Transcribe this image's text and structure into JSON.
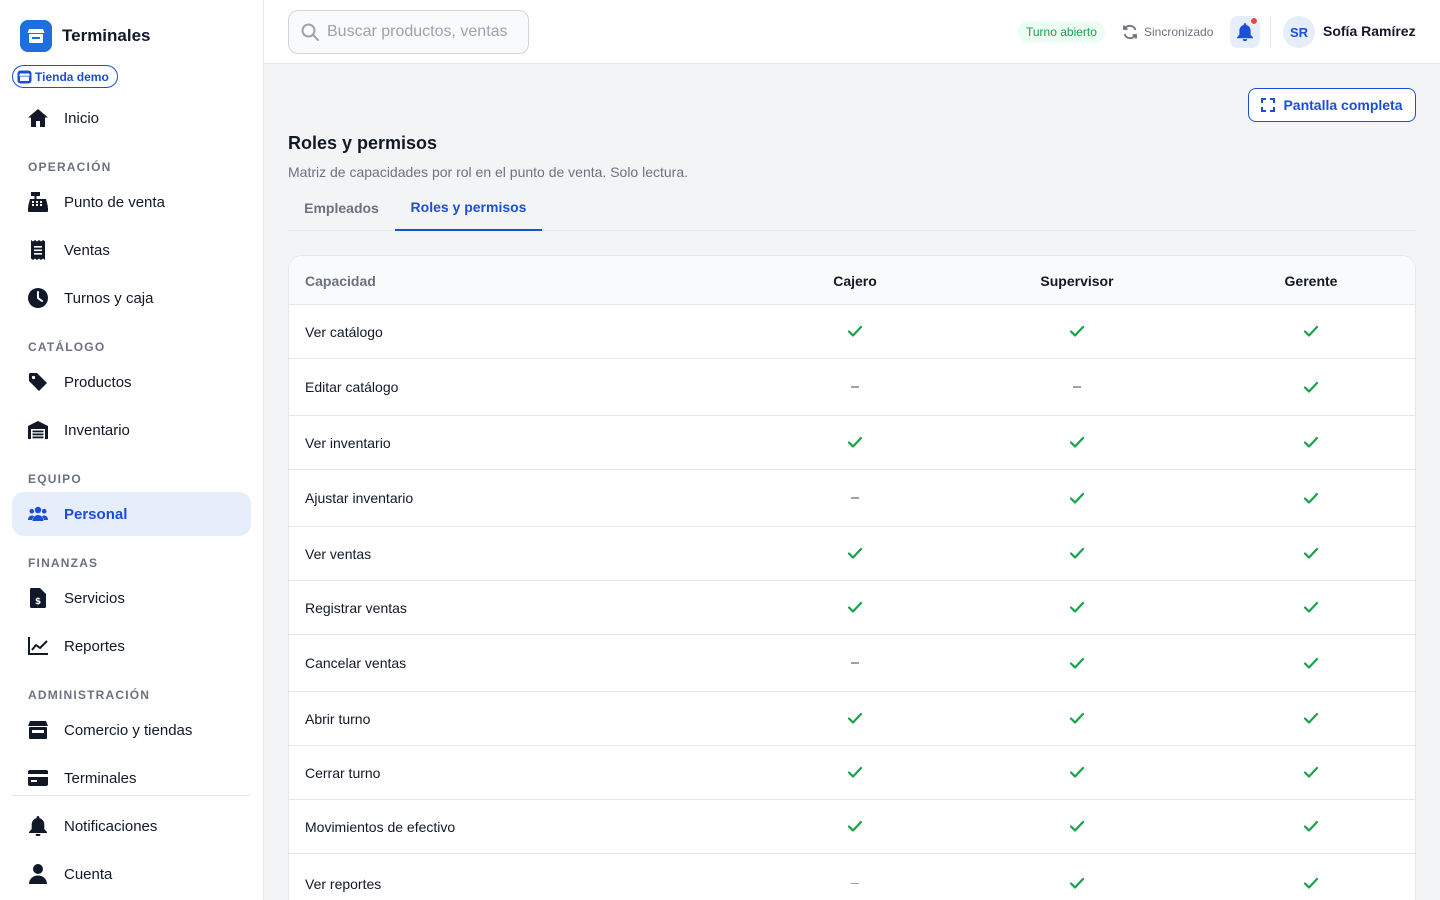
{
  "brand": {
    "name": "Terminales",
    "store": "Tienda demo"
  },
  "sidebar": {
    "home": "Inicio",
    "sections": {
      "operacion": "OPERACIÓN",
      "catalogo": "CATÁLOGO",
      "equipo": "EQUIPO",
      "finanzas": "FINANZAS",
      "administracion": "ADMINISTRACIÓN"
    },
    "items": {
      "pos": "Punto de venta",
      "ventas": "Ventas",
      "turnos": "Turnos y caja",
      "productos": "Productos",
      "inventario": "Inventario",
      "personal": "Personal",
      "servicios": "Servicios",
      "reportes": "Reportes",
      "comercio": "Comercio y tiendas",
      "terminales": "Terminales",
      "notificaciones": "Notificaciones",
      "cuenta": "Cuenta"
    },
    "active": "personal"
  },
  "topbar": {
    "search_placeholder": "Buscar productos, ventas",
    "shift_status": "Turno abierto",
    "sync_status": "Sincronizado",
    "user_initials": "SR",
    "user_name": "Sofía Ramírez"
  },
  "page": {
    "fullscreen_label": "Pantalla completa",
    "title": "Roles y permisos",
    "subtitle": "Matriz de capacidades por rol en el punto de venta. Solo lectura.",
    "tabs": [
      "Empleados",
      "Roles y permisos"
    ],
    "active_tab": 1
  },
  "table": {
    "headers": [
      "Capacidad",
      "Cajero",
      "Supervisor",
      "Gerente"
    ],
    "rows": [
      {
        "capability": "Ver catálogo",
        "perms": [
          true,
          true,
          true
        ]
      },
      {
        "capability": "Editar catálogo",
        "perms": [
          false,
          false,
          true
        ]
      },
      {
        "capability": "Ver inventario",
        "perms": [
          true,
          true,
          true
        ]
      },
      {
        "capability": "Ajustar inventario",
        "perms": [
          false,
          true,
          true
        ]
      },
      {
        "capability": "Ver ventas",
        "perms": [
          true,
          true,
          true
        ]
      },
      {
        "capability": "Registrar ventas",
        "perms": [
          true,
          true,
          true
        ]
      },
      {
        "capability": "Cancelar ventas",
        "perms": [
          false,
          true,
          true
        ]
      },
      {
        "capability": "Abrir turno",
        "perms": [
          true,
          true,
          true
        ]
      },
      {
        "capability": "Cerrar turno",
        "perms": [
          true,
          true,
          true
        ]
      },
      {
        "capability": "Movimientos de efectivo",
        "perms": [
          true,
          true,
          true
        ]
      },
      {
        "capability": "Ver reportes",
        "perms": [
          false,
          true,
          true
        ]
      }
    ]
  },
  "colors": {
    "accent": "#1d4ed8",
    "brand": "#1d6fe0",
    "success": "#16a34a",
    "notification_dot": "#ef4444"
  }
}
